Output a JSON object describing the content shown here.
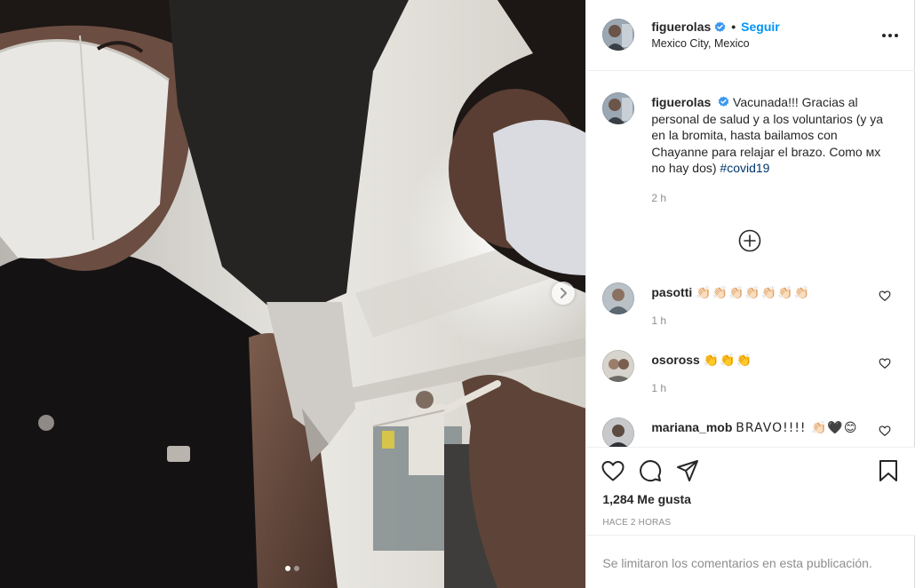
{
  "post": {
    "author": {
      "username": "figuerolas",
      "verified": true,
      "location": "Mexico City, Mexico",
      "follow_label": "Seguir",
      "separator": "•"
    },
    "caption": {
      "text": "Vacunada!!! Gracias al personal de salud y a los voluntarios (y ya en la bromita, hasta bailamos con Chayanne para relajar el brazo. Como ᴍx no hay dos)",
      "hashtag": "#covid19",
      "time": "2 h"
    },
    "carousel": {
      "total_slides": 2,
      "current_slide": 1
    },
    "comments": [
      {
        "username": "pasotti",
        "text": "👏🏻👏🏻👏🏻👏🏻👏🏻👏🏻👏🏻",
        "time": "1 h"
      },
      {
        "username": "osoross",
        "text": "👏👏👏",
        "time": "1 h"
      },
      {
        "username": "mariana_mob",
        "text": "BRAVO!!!! 👏🏻🖤😊",
        "time": ""
      }
    ],
    "likes_label": "1,284 Me gusta",
    "posted_ago": "HACE 2 HORAS",
    "comments_disabled_text": "Se limitaron los comentarios en esta publicación."
  },
  "colors": {
    "link_blue": "#0095f6",
    "hashtag_blue": "#00376b",
    "muted_gray": "#8e8e8e",
    "text": "#262626"
  },
  "icons": [
    "verified-badge-icon",
    "more-options-icon",
    "chevron-right-icon",
    "add-circle-icon",
    "heart-icon",
    "comment-icon",
    "share-icon",
    "bookmark-icon"
  ]
}
